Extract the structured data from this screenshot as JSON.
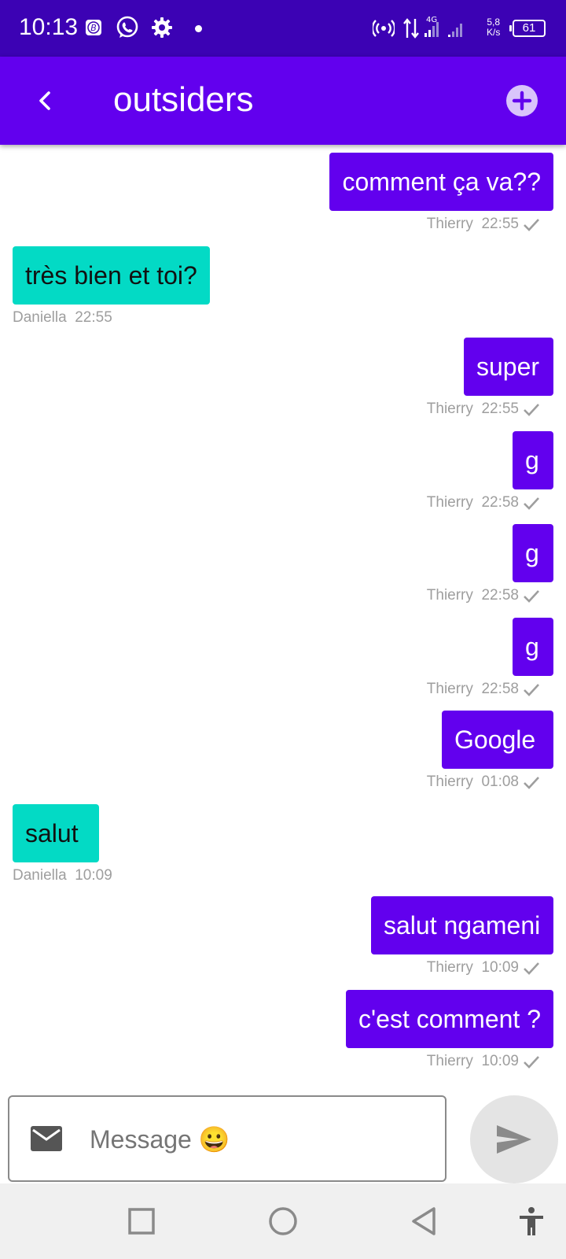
{
  "status_bar": {
    "time": "10:13",
    "network": "4G",
    "speed_value": "5,8",
    "speed_unit": "K/s",
    "battery": "61",
    "icons": [
      "bitcoin-app-icon",
      "whatsapp-icon",
      "settings-icon",
      "notification-dot",
      "hotspot-icon",
      "data-transfer-icon",
      "signal-bars-icon",
      "battery-icon"
    ]
  },
  "app_bar": {
    "title": "outsiders",
    "back_icon": "chevron-left-icon",
    "add_icon": "add-circle-icon"
  },
  "messages": [
    {
      "direction": "out",
      "text": "comment ça va??",
      "sender": "Thierry",
      "time": "22:55",
      "read": true
    },
    {
      "direction": "in",
      "text": "très bien et toi?",
      "sender": "Daniella",
      "time": "22:55",
      "read": false
    },
    {
      "direction": "out",
      "text": "super",
      "sender": "Thierry",
      "time": "22:55",
      "read": true
    },
    {
      "direction": "out",
      "text": "g",
      "sender": "Thierry",
      "time": "22:58",
      "read": true
    },
    {
      "direction": "out",
      "text": "g",
      "sender": "Thierry",
      "time": "22:58",
      "read": true
    },
    {
      "direction": "out",
      "text": "g",
      "sender": "Thierry",
      "time": "22:58",
      "read": true
    },
    {
      "direction": "out",
      "text": "Google",
      "sender": "Thierry",
      "time": "01:08",
      "read": true
    },
    {
      "direction": "in",
      "text": "salut",
      "sender": "Daniella",
      "time": "10:09",
      "read": false
    },
    {
      "direction": "out",
      "text": "salut ngameni",
      "sender": "Thierry",
      "time": "10:09",
      "read": true
    },
    {
      "direction": "out",
      "text": "c'est comment ?",
      "sender": "Thierry",
      "time": "10:09",
      "read": true
    }
  ],
  "composer": {
    "placeholder": "Message 😀",
    "value": "",
    "mail_icon": "mail-icon",
    "send_icon": "send-icon"
  },
  "nav_bar": {
    "buttons": [
      "recents-square-icon",
      "home-circle-icon",
      "back-triangle-icon",
      "accessibility-icon"
    ]
  },
  "colors": {
    "status_bar": "#3c02b4",
    "app_bar": "#6200ee",
    "outgoing_bubble": "#6200ee",
    "incoming_bubble": "#03dac5",
    "meta_text": "#9e9e9e",
    "send_button": "#e4e4e4",
    "nav_bar": "#f0f0f0"
  }
}
